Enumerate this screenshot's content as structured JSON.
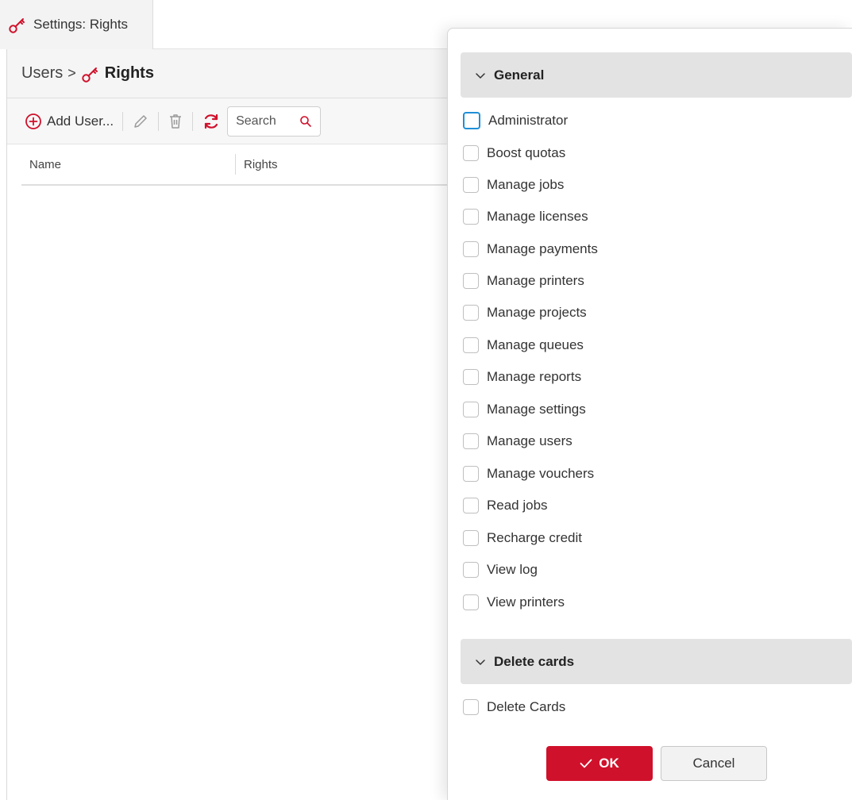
{
  "tab": {
    "label": "Settings: Rights"
  },
  "breadcrumb": {
    "parent": "Users",
    "separator": ">",
    "current": "Rights"
  },
  "toolbar": {
    "add_label": "Add User...",
    "search_placeholder": "Search"
  },
  "table": {
    "columns": [
      "Name",
      "Rights"
    ]
  },
  "dialog": {
    "sections": [
      {
        "title": "General",
        "items": [
          {
            "label": "Administrator",
            "checked": false,
            "focused": true
          },
          {
            "label": "Boost quotas",
            "checked": false
          },
          {
            "label": "Manage jobs",
            "checked": false
          },
          {
            "label": "Manage licenses",
            "checked": false
          },
          {
            "label": "Manage payments",
            "checked": false
          },
          {
            "label": "Manage printers",
            "checked": false
          },
          {
            "label": "Manage projects",
            "checked": false
          },
          {
            "label": "Manage queues",
            "checked": false
          },
          {
            "label": "Manage reports",
            "checked": false
          },
          {
            "label": "Manage settings",
            "checked": false
          },
          {
            "label": "Manage users",
            "checked": false
          },
          {
            "label": "Manage vouchers",
            "checked": false
          },
          {
            "label": "Read jobs",
            "checked": false
          },
          {
            "label": "Recharge credit",
            "checked": false
          },
          {
            "label": "View log",
            "checked": false
          },
          {
            "label": "View printers",
            "checked": false
          }
        ]
      },
      {
        "title": "Delete cards",
        "items": [
          {
            "label": "Delete Cards",
            "checked": false
          }
        ]
      }
    ],
    "ok_label": "OK",
    "cancel_label": "Cancel"
  },
  "colors": {
    "accent": "#d0112b",
    "focus": "#1f8fd8",
    "section_bg": "#e3e3e3"
  }
}
